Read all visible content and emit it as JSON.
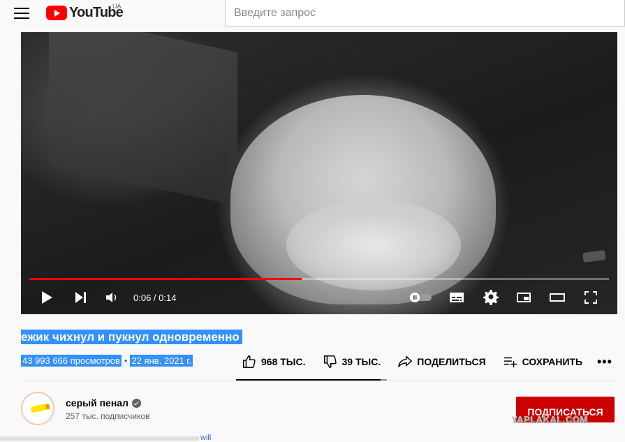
{
  "header": {
    "logo_text": "YouTube",
    "country": "UA",
    "search_placeholder": "Введите запрос"
  },
  "player": {
    "time": "0:06 / 0:14",
    "progress_fraction": 0.47
  },
  "video": {
    "title": "ежик чихнул и пукнул одновременно",
    "views": "43 993 666 просмотров",
    "separator": "•",
    "date": "22 янв. 2021 г."
  },
  "actions": {
    "likes": "968 ТЫС.",
    "dislikes": "39 ТЫС.",
    "share": "ПОДЕЛИТЬСЯ",
    "save": "СОХРАНИТЬ",
    "more": "•••",
    "like_ratio": 0.96
  },
  "channel": {
    "name": "серый пенал",
    "subscribers": "257 тыс. подписчиков",
    "subscribe_label": "ПОДПИСАТЬСЯ"
  },
  "watermark": "YAPLAKAL.COM",
  "bottom_fragment": "will"
}
